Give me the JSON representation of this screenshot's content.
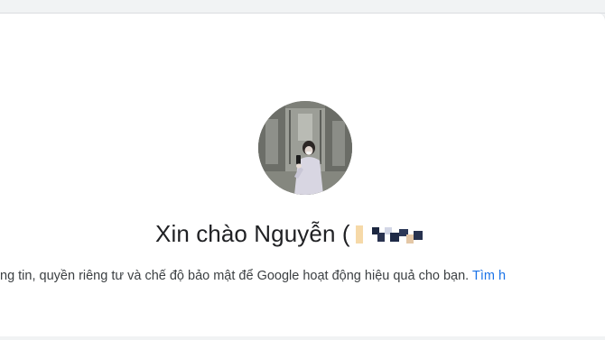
{
  "greeting": {
    "text": "Xin chào Nguyễn (",
    "redacted": true
  },
  "subtitle": {
    "text": "ng tin, quyền riêng tư và chế độ bảo mật để Google hoạt động hiệu quả cho bạn. ",
    "link": "Tìm h"
  },
  "colors": {
    "background": "#f1f3f4",
    "card": "#ffffff",
    "text": "#202124",
    "link": "#1a73e8"
  },
  "icons": {
    "avatar": "profile-photo"
  }
}
